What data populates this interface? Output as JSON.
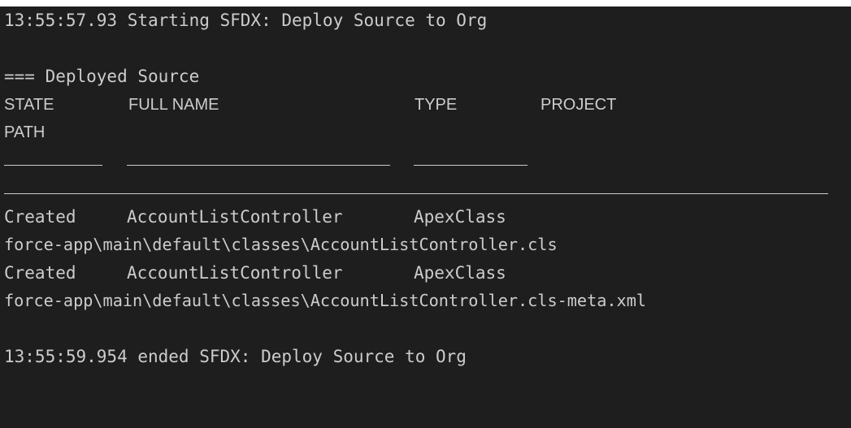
{
  "terminal": {
    "start_line": "13:55:57.93 Starting SFDX: Deploy Source to Org",
    "section_header": "=== Deployed Source",
    "columns": {
      "state": "STATE",
      "full_name": "FULL NAME",
      "type": "TYPE",
      "project": "PROJECT",
      "path": "PATH"
    },
    "rows": [
      {
        "state": "Created",
        "full_name": "AccountListController",
        "type": "ApexClass",
        "path": "force-app\\main\\default\\classes\\AccountListController.cls"
      },
      {
        "state": "Created",
        "full_name": "AccountListController",
        "type": "ApexClass",
        "path": "force-app\\main\\default\\classes\\AccountListController.cls-meta.xml"
      }
    ],
    "end_line": "13:55:59.954 ended SFDX: Deploy Source to Org"
  },
  "colors": {
    "background": "#1e1e1e",
    "text": "#cccccc"
  }
}
